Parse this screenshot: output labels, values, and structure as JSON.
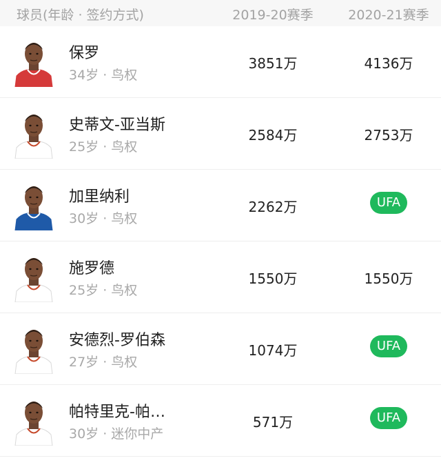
{
  "header": {
    "player_label": "球员(年龄 · 签约方式)",
    "season1_label": "2019-20赛季",
    "season2_label": "2020-21赛季"
  },
  "players": [
    {
      "name": "保罗",
      "meta": "34岁 · 鸟权",
      "salary_2019_20": "3851万",
      "salary_2020_21": "4136万",
      "jersey_color": "#d53a3a"
    },
    {
      "name": "史蒂文-亚当斯",
      "meta": "25岁 · 鸟权",
      "salary_2019_20": "2584万",
      "salary_2020_21": "2753万",
      "jersey_color": "#ffffff"
    },
    {
      "name": "加里纳利",
      "meta": "30岁 · 鸟权",
      "salary_2019_20": "2262万",
      "salary_2020_21": "UFA",
      "jersey_color": "#1f5aa8"
    },
    {
      "name": "施罗德",
      "meta": "25岁 · 鸟权",
      "salary_2019_20": "1550万",
      "salary_2020_21": "1550万",
      "jersey_color": "#ffffff"
    },
    {
      "name": "安德烈-罗伯森",
      "meta": "27岁 · 鸟权",
      "salary_2019_20": "1074万",
      "salary_2020_21": "UFA",
      "jersey_color": "#ffffff"
    },
    {
      "name": "帕特里克-帕…",
      "meta": "30岁 · 迷你中产",
      "salary_2019_20": "571万",
      "salary_2020_21": "UFA",
      "jersey_color": "#ffffff"
    }
  ],
  "colors": {
    "ufa_badge": "#1fb95c",
    "header_bg": "#f7f7f7",
    "header_text": "#a3a3a3"
  }
}
